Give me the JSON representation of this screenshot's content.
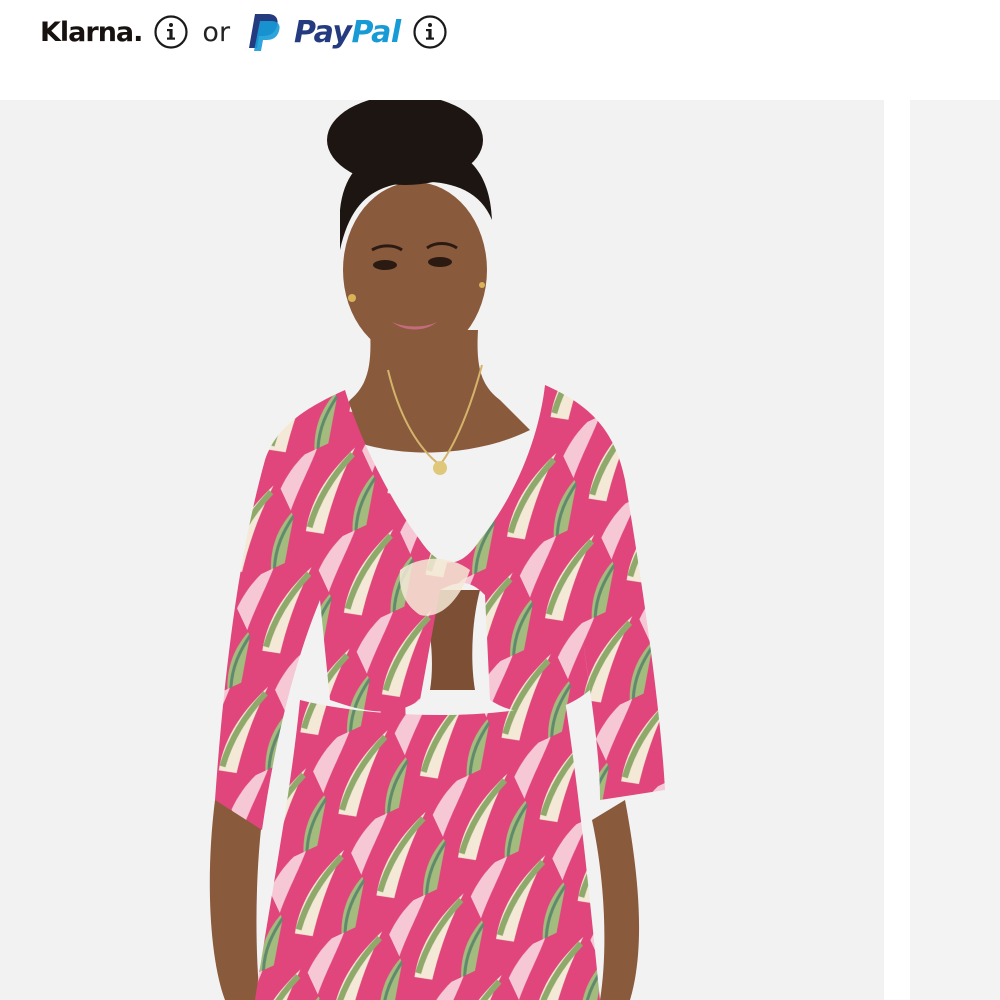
{
  "payment": {
    "klarna_label": "Klarna",
    "klarna_dot": ".",
    "or_text": "or",
    "paypal_label_a": "Pay",
    "paypal_label_b": "Pal",
    "info_icon": "info-circle-icon",
    "colors": {
      "klarna": "#17120f",
      "paypal_dark": "#253b80",
      "paypal_light": "#179bd7"
    }
  },
  "product": {
    "image": "model-wearing-pink-tropical-leaf-print-tie-front-top-and-pants",
    "colors": {
      "background": "#f2f2f2",
      "print_pink": "#e0457b",
      "leaf_green": "#8fa96a",
      "leaf_cream": "#f3e9d6",
      "skin": "#8a5a3c",
      "hair": "#1c1512"
    }
  }
}
